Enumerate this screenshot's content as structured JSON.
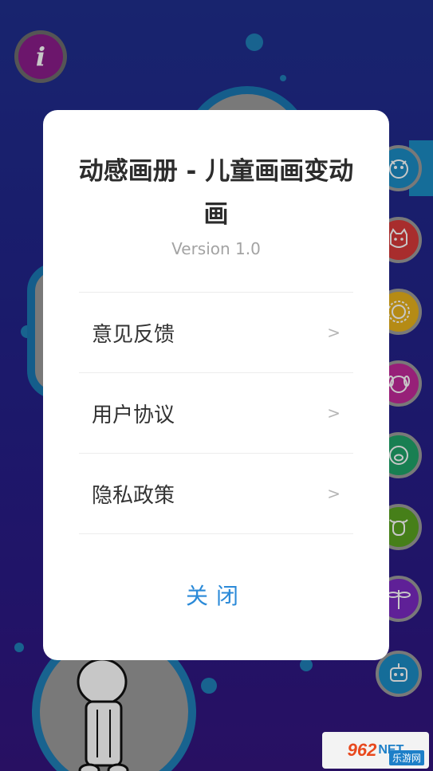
{
  "app": {
    "info_icon_glyph": "i"
  },
  "dialog": {
    "title": "动感画册 - 儿童画画变动画",
    "version": "Version 1.0",
    "items": [
      {
        "label": "意见反馈",
        "arrow": ">"
      },
      {
        "label": "用户协议",
        "arrow": ">"
      },
      {
        "label": "隐私政策",
        "arrow": ">"
      }
    ],
    "close_label": "关闭"
  },
  "side_animals": [
    {
      "icon": "dragon-icon",
      "color": "#1b8cc4"
    },
    {
      "icon": "cat-icon",
      "color": "#d83a3a"
    },
    {
      "icon": "lion-icon",
      "color": "#e8b21c"
    },
    {
      "icon": "dog-icon",
      "color": "#c22a9a"
    },
    {
      "icon": "pig-icon",
      "color": "#1fa36a"
    },
    {
      "icon": "cow-icon",
      "color": "#5aa321"
    },
    {
      "icon": "dragonfly-icon",
      "color": "#7a2ac2"
    },
    {
      "icon": "robot-icon",
      "color": "#1b8cc4"
    }
  ],
  "watermark": {
    "number": "962",
    "suffix": "NET",
    "subtitle": "乐游网"
  },
  "colors": {
    "accent": "#2b8ad8",
    "background_top": "#1f2f8e",
    "background_bottom": "#34157e"
  }
}
